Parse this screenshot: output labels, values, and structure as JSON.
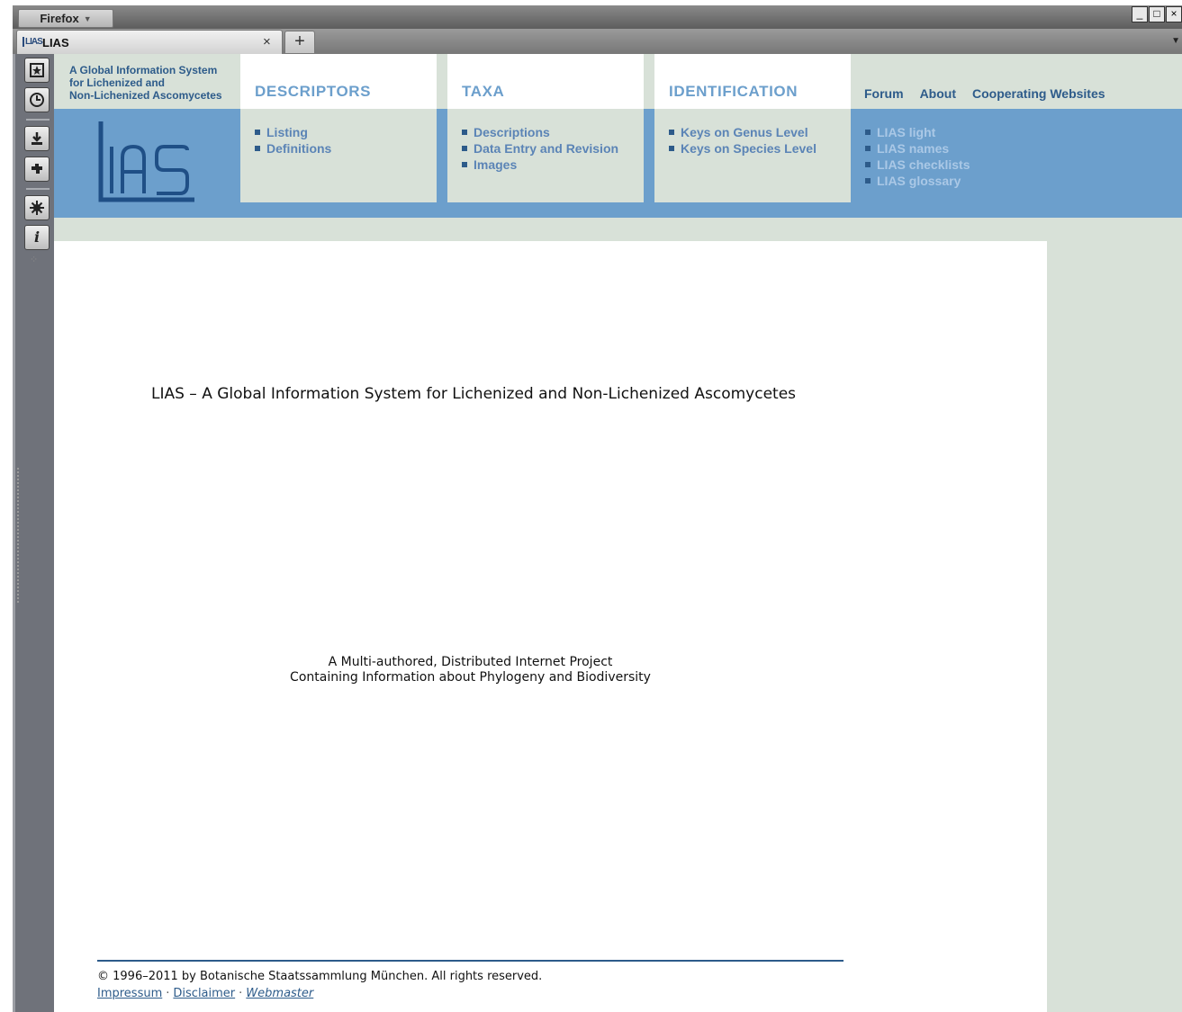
{
  "browser": {
    "app_button": "Firefox",
    "tab_title": "LIAS",
    "tab_favicon": "LIAS",
    "tab_close": "×",
    "new_tab": "+",
    "window_controls": [
      "_",
      "□",
      "×"
    ],
    "sidebar_icons": [
      "bookmarks-icon",
      "history-icon",
      "downloads-icon",
      "addons-icon",
      "settings-icon",
      "info-icon"
    ]
  },
  "site": {
    "tagline_lines": [
      "A Global Information System",
      "for Lichenized and",
      "Non-Lichenized Ascomycetes"
    ],
    "logo_text": "LIAS",
    "colors": {
      "accent": "#6c9fcc",
      "dark_blue": "#2d5b8a",
      "background": "#d8e1d8"
    }
  },
  "menu": {
    "descriptors": {
      "heading": "DESCRIPTORS",
      "items": [
        "Listing",
        "Definitions"
      ]
    },
    "taxa": {
      "heading": "TAXA",
      "items": [
        "Descriptions",
        "Data Entry and Revision",
        "Images"
      ]
    },
    "identification": {
      "heading": "IDENTIFICATION",
      "items": [
        "Keys on Genus Level",
        "Keys on Species Level"
      ]
    }
  },
  "top_links": [
    "Forum",
    "About",
    "Cooperating Websites"
  ],
  "external_links": [
    "LIAS light",
    "LIAS names",
    "LIAS checklists",
    "LIAS glossary"
  ],
  "main": {
    "title": "LIAS – A Global Information System for Lichenized and Non-Lichenized Ascomycetes",
    "subtitle_line1": "A Multi-authored, Distributed Internet Project",
    "subtitle_line2": "Containing Information about Phylogeny and Biodiversity"
  },
  "footer": {
    "copyright": "© 1996–2011 by Botanische Staatssammlung München. All rights reserved.",
    "links": [
      "Impressum",
      "Disclaimer",
      "Webmaster"
    ],
    "separator": "·"
  }
}
